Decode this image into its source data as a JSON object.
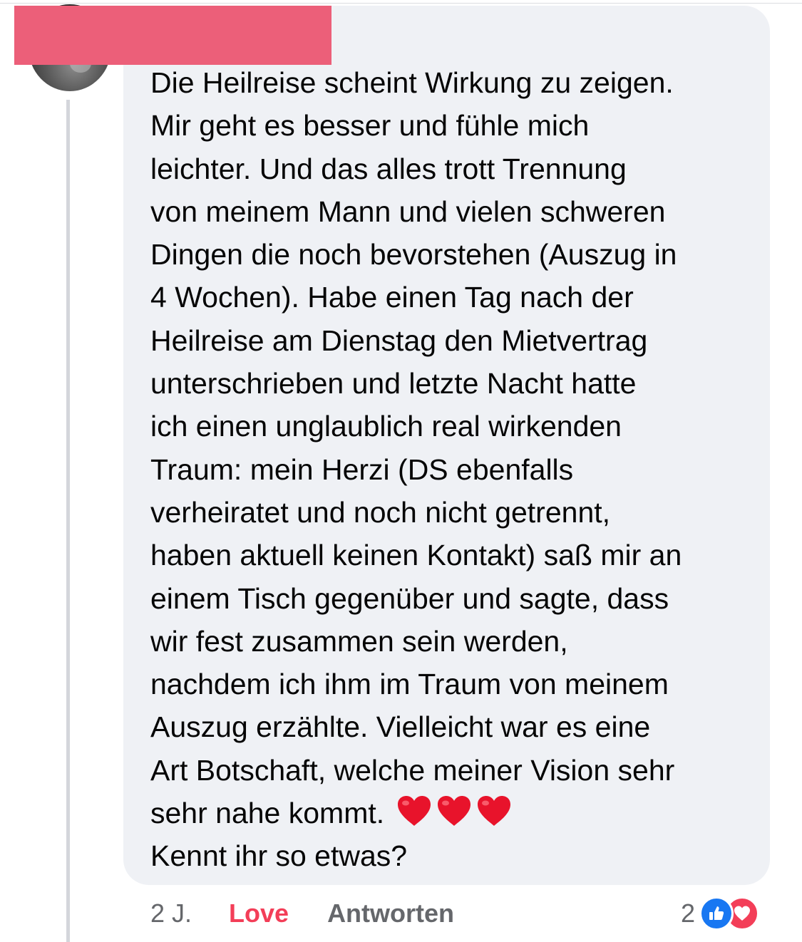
{
  "comment": {
    "author_name_redacted": true,
    "text_lines": [
      "Die Heilreise scheint Wirkung zu zeigen.",
      "Mir geht es besser und fühle mich",
      "leichter. Und das alles trott Trennung",
      "von meinem Mann und vielen schweren",
      "Dingen die noch bevorstehen (Auszug in",
      "4 Wochen). Habe einen Tag nach der",
      "Heilreise am Dienstag den Mietvertrag",
      "unterschrieben und letzte Nacht hatte",
      "ich einen unglaublich real wirkenden",
      "Traum: mein Herzi (DS ebenfalls",
      "verheiratet und noch nicht getrennt,",
      "haben aktuell keinen Kontakt) saß mir an",
      "einem Tisch gegenüber und sagte, dass",
      "wir fest zusammen sein werden,",
      "nachdem ich ihm im Traum von meinem",
      "Auszug erzählte. Vielleicht war es eine",
      "Art Botschaft, welche meiner Vision sehr"
    ],
    "last_line_text": "sehr nahe kommt. ",
    "emojis": [
      "❤️",
      "❤️",
      "❤️"
    ],
    "closing_line": "Kennt ihr so etwas?"
  },
  "actions": {
    "timestamp": "2 J.",
    "love_label": "Love",
    "reply_label": "Antworten"
  },
  "reactions": {
    "count": "2",
    "icons": [
      "like-icon",
      "love-icon"
    ]
  },
  "colors": {
    "bubble_background": "#eff1f5",
    "love_accent": "#f33e58",
    "like_blue": "#1877f2",
    "secondary_text": "#65676b",
    "redaction": "#ec5f79"
  }
}
